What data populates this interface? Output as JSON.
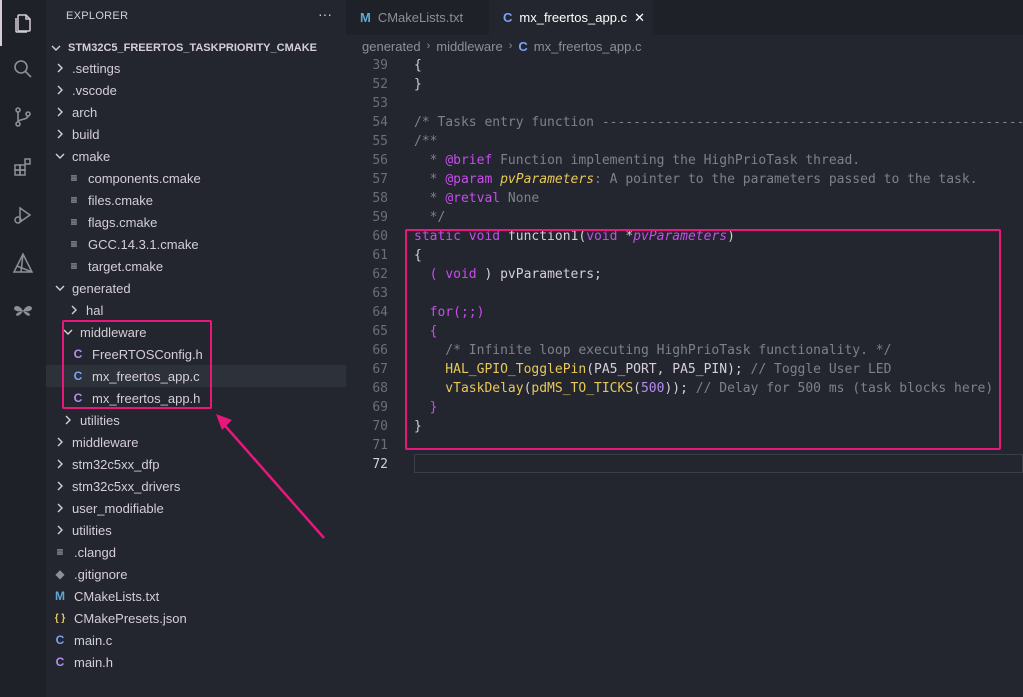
{
  "explorer": {
    "title": "EXPLORER",
    "more": "···",
    "root": "STM32C5_FREERTOS_TASKPRIORITY_CMAKE",
    "items": [
      {
        "label": ".settings",
        "kind": "folder-closed"
      },
      {
        "label": ".vscode",
        "kind": "folder-closed"
      },
      {
        "label": "arch",
        "kind": "folder-closed"
      },
      {
        "label": "build",
        "kind": "folder-closed"
      },
      {
        "label": "cmake",
        "kind": "folder-open"
      },
      {
        "label": "components.cmake",
        "kind": "lines-file"
      },
      {
        "label": "files.cmake",
        "kind": "lines-file"
      },
      {
        "label": "flags.cmake",
        "kind": "lines-file"
      },
      {
        "label": "GCC.14.3.1.cmake",
        "kind": "lines-file"
      },
      {
        "label": "target.cmake",
        "kind": "lines-file"
      },
      {
        "label": "generated",
        "kind": "folder-open"
      },
      {
        "label": "hal",
        "kind": "folder-closed"
      },
      {
        "label": "middleware",
        "kind": "folder-open"
      },
      {
        "label": "FreeRTOSConfig.h",
        "kind": "h-file"
      },
      {
        "label": "mx_freertos_app.c",
        "kind": "c-file"
      },
      {
        "label": "mx_freertos_app.h",
        "kind": "h-file"
      },
      {
        "label": "utilities",
        "kind": "folder-closed"
      },
      {
        "label": "middleware",
        "kind": "folder-closed"
      },
      {
        "label": "stm32c5xx_dfp",
        "kind": "folder-closed"
      },
      {
        "label": "stm32c5xx_drivers",
        "kind": "folder-closed"
      },
      {
        "label": "user_modifiable",
        "kind": "folder-closed"
      },
      {
        "label": "utilities",
        "kind": "folder-closed"
      },
      {
        "label": ".clangd",
        "kind": "lines-file"
      },
      {
        "label": ".gitignore",
        "kind": "git-file"
      },
      {
        "label": "CMakeLists.txt",
        "kind": "cmake-file"
      },
      {
        "label": "CMakePresets.json",
        "kind": "json-file"
      },
      {
        "label": "main.c",
        "kind": "c-file"
      },
      {
        "label": "main.h",
        "kind": "h-file"
      }
    ],
    "icon_glyphs": {
      "c": "C",
      "h": "C",
      "cmake": "M",
      "json": "{ }"
    }
  },
  "tabs": [
    {
      "label": "CMakeLists.txt",
      "icon": "M",
      "active": false
    },
    {
      "label": "mx_freertos_app.c",
      "icon": "C",
      "active": true,
      "close": "✕"
    }
  ],
  "breadcrumb": {
    "parts": [
      "generated",
      "middleware"
    ],
    "file_icon": "C",
    "file": "mx_freertos_app.c",
    "sep": "›"
  },
  "editor": {
    "line_numbers": [
      "39",
      "52",
      "53",
      "54",
      "55",
      "56",
      "57",
      "58",
      "59",
      "60",
      "61",
      "62",
      "63",
      "64",
      "65",
      "66",
      "67",
      "68",
      "69",
      "70",
      "71",
      "72"
    ],
    "current_line": "72",
    "text": {
      "l39": "{",
      "l52": "}",
      "l54_comment": "/* Tasks entry function ------------------------------------------------------*/",
      "l55": "/**",
      "l56_star": "  * ",
      "l56_tag": "@brief",
      "l56_rest": " Function implementing the HighPrioTask thread.",
      "l57_star": "  * ",
      "l57_tag": "@param",
      "l57_param": " pvParameters",
      "l57_rest": ": A pointer to the parameters passed to the task.",
      "l58_star": "  * ",
      "l58_tag": "@retval",
      "l58_rest": " None",
      "l59": "  */",
      "l60_kw": "static void ",
      "l60_fn": "function1",
      "l60_open": "(",
      "l60_type": "void ",
      "l60_star": "*",
      "l60_param": "pvParameters",
      "l60_close": ")",
      "l61": "{",
      "l62_pre": "  ( ",
      "l62_kw": "void",
      "l62_post": " ) pvParameters;",
      "l64_kw": "  for",
      "l64_rest": "(;;)",
      "l65": "  {",
      "l66": "    /* Infinite loop executing HighPrioTask functionality. */",
      "l67_fn": "    HAL_GPIO_TogglePin",
      "l67_args": "(PA5_PORT, PA5_PIN);",
      "l67_cm": " // Toggle User LED",
      "l68_fn": "    vTaskDelay",
      "l68_open": "(",
      "l68_fn2": "pdMS_TO_TICKS",
      "l68_open2": "(",
      "l68_num": "500",
      "l68_close": "));",
      "l68_cm": " // Delay for 500 ms (task blocks here)",
      "l69": "  }",
      "l70": "}"
    }
  },
  "colors": {
    "highlight": "#e8177b",
    "background": "#23262e",
    "activity_bar": "#1e2128"
  },
  "activity_icons": [
    "files-icon",
    "search-icon",
    "source-control-icon",
    "extensions-icon",
    "run-debug-icon",
    "cmake-icon",
    "stm32-icon"
  ],
  "activity_labels": {
    "stm32": "STM32"
  }
}
